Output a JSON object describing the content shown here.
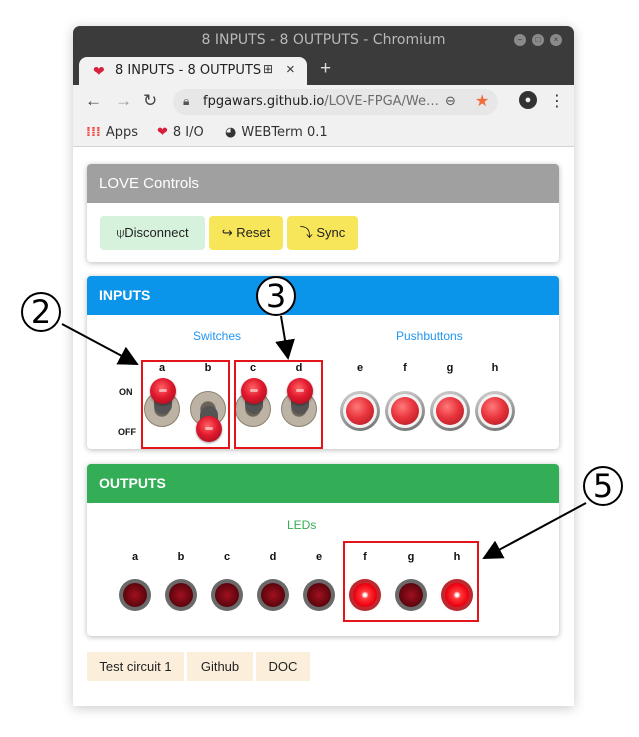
{
  "window": {
    "title": "8 INPUTS - 8 OUTPUTS - Chromium",
    "tab_title": "8 INPUTS - 8 OUTPUTS",
    "new_tab": "+",
    "url_host": "fpgawars.github.io",
    "url_path": "/LOVE-FPGA/We…"
  },
  "bookmarks": [
    {
      "label": "Apps",
      "icon": "apps-grid-icon"
    },
    {
      "label": "8 I/O",
      "icon": "heart-icon"
    },
    {
      "label": "WEBTerm 0.1",
      "icon": "globe-icon"
    }
  ],
  "love_controls": {
    "title": "LOVE Controls",
    "buttons": [
      {
        "label": "Disconnect",
        "icon": "plug-icon"
      },
      {
        "label": "Reset",
        "icon": "return-arrow-icon"
      },
      {
        "label": "Sync",
        "icon": "sync-arrow-icon"
      }
    ]
  },
  "inputs": {
    "title": "INPUTS",
    "switches_title": "Switches",
    "pushbuttons_title": "Pushbuttons",
    "on_label": "ON",
    "off_label": "OFF",
    "switches": [
      {
        "label": "a",
        "state": "on"
      },
      {
        "label": "b",
        "state": "off"
      },
      {
        "label": "c",
        "state": "on"
      },
      {
        "label": "d",
        "state": "on"
      }
    ],
    "pushbuttons": [
      {
        "label": "e"
      },
      {
        "label": "f"
      },
      {
        "label": "g"
      },
      {
        "label": "h"
      }
    ]
  },
  "outputs": {
    "title": "OUTPUTS",
    "leds_title": "LEDs",
    "leds": [
      {
        "label": "a",
        "on": false
      },
      {
        "label": "b",
        "on": false
      },
      {
        "label": "c",
        "on": false
      },
      {
        "label": "d",
        "on": false
      },
      {
        "label": "e",
        "on": false
      },
      {
        "label": "f",
        "on": true
      },
      {
        "label": "g",
        "on": false
      },
      {
        "label": "h",
        "on": true
      }
    ]
  },
  "footer": {
    "links": [
      "Test circuit 1",
      "Github",
      "DOC"
    ]
  },
  "annotations": {
    "callout_switches_ab": "2",
    "callout_switches_cd": "3",
    "callout_leds": "5"
  },
  "colors": {
    "inputs_header": "#0a94ea",
    "outputs_header": "#33ad56",
    "controls_header": "#a0a0a0",
    "section_switches_text": "#2196f3",
    "section_leds_text": "#33ad56",
    "highlight_box": "#e3151b"
  }
}
